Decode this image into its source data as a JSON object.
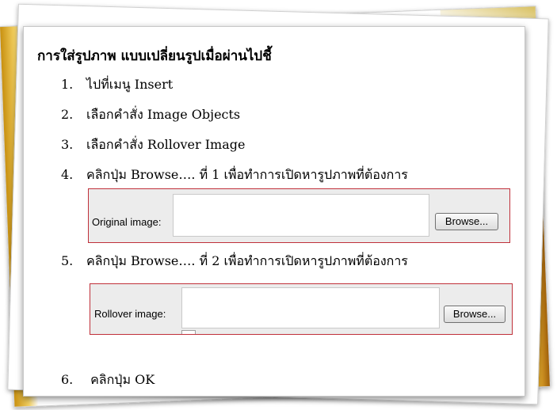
{
  "title": "การใส่รูปภาพ แบบเปลี่ยนรูปเมื่อผ่านไปชี้",
  "steps": [
    {
      "num": "1.",
      "text": "ไปที่เมนู Insert"
    },
    {
      "num": "2.",
      "text": "เลือกคำสั่ง  Image Objects"
    },
    {
      "num": "3.",
      "text": "เลือกคำสั่ง Rollover Image"
    },
    {
      "num": "4.",
      "text": "คลิกปุ่ม Browse…. ที่   1   เพื่อทำการเปิดหารูปภาพที่ต้องการ"
    },
    {
      "num": "5.",
      "text": "คลิกปุ่ม Browse…. ที่   2   เพื่อทำการเปิดหารูปภาพที่ต้องการ"
    },
    {
      "num": "6.",
      "text": " คลิกปุ่ม     OK"
    }
  ],
  "original_dialog": {
    "label": "Original image:",
    "input_value": "",
    "button": "Browse..."
  },
  "rollover_dialog": {
    "label": "Rollover image:",
    "input_value": "",
    "button": "Browse..."
  }
}
